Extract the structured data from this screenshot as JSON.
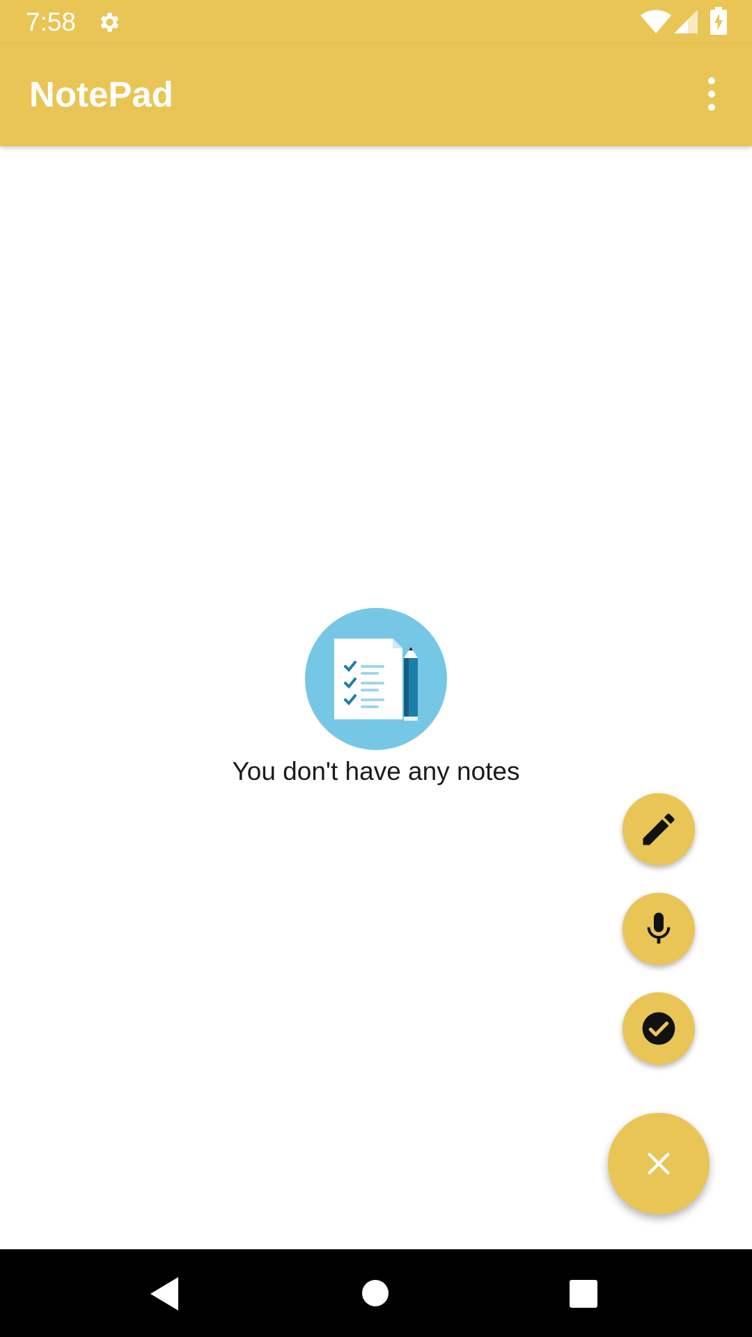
{
  "status_bar": {
    "time": "7:58",
    "icons": [
      "gear-icon",
      "wifi-icon",
      "signal-icon",
      "battery-charging-icon"
    ]
  },
  "app_bar": {
    "title": "NotePad",
    "menu_icon": "more-vert-icon"
  },
  "empty_state": {
    "illustration": "notes-checklist-illustration",
    "message": "You don't have any notes"
  },
  "fab_menu": {
    "items": [
      {
        "icon": "pencil-icon"
      },
      {
        "icon": "microphone-icon"
      },
      {
        "icon": "checklist-icon"
      }
    ],
    "main_icon": "close-icon"
  },
  "navigation_bar": {
    "buttons": [
      "back-icon",
      "home-icon",
      "recents-icon"
    ]
  },
  "colors": {
    "primary": "#e9c555",
    "illustration_bg": "#76c7e6",
    "text": "#1a1a1a",
    "nav_bar": "#000000"
  }
}
